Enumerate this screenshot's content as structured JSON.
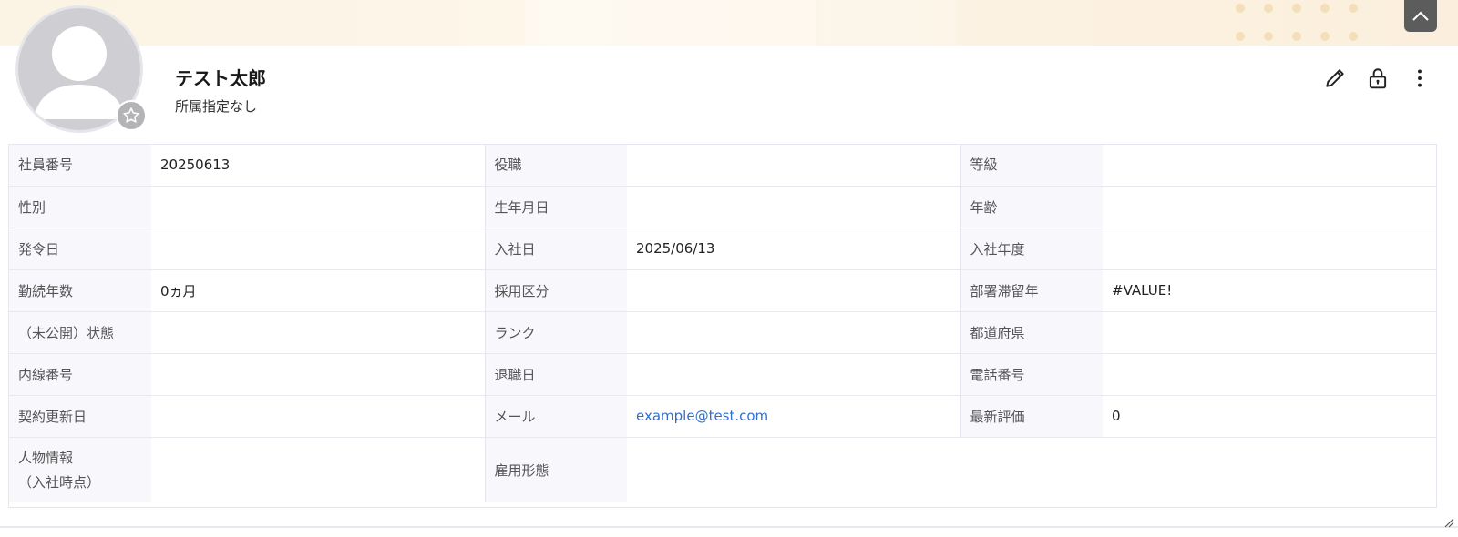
{
  "profile": {
    "name": "テスト太郎",
    "department": "所属指定なし"
  },
  "icons": {
    "scroll_top": "chevron-up-icon",
    "favorite": "star-icon",
    "edit": "pencil-icon",
    "lock": "lock-icon",
    "more": "more-vertical-icon"
  },
  "fields": {
    "row1": {
      "l1": "社員番号",
      "v1": "20250613",
      "l2": "役職",
      "v2": "",
      "l3": "等級",
      "v3": ""
    },
    "row2": {
      "l1": "性別",
      "v1": "",
      "l2": "生年月日",
      "v2": "",
      "l3": "年齢",
      "v3": ""
    },
    "row3": {
      "l1": "発令日",
      "v1": "",
      "l2": "入社日",
      "v2": "2025/06/13",
      "l3": "入社年度",
      "v3": ""
    },
    "row4": {
      "l1": "勤続年数",
      "v1": "0ヵ月",
      "l2": "採用区分",
      "v2": "",
      "l3": "部署滞留年",
      "v3": "#VALUE!"
    },
    "row5": {
      "l1": "（未公開）状態",
      "v1": "",
      "l2": "ランク",
      "v2": "",
      "l3": "都道府県",
      "v3": ""
    },
    "row6": {
      "l1": "内線番号",
      "v1": "",
      "l2": "退職日",
      "v2": "",
      "l3": "電話番号",
      "v3": ""
    },
    "row7": {
      "l1": "契約更新日",
      "v1": "",
      "l2": "メール",
      "v2": "example@test.com",
      "l3": "最新評価",
      "v3": "0"
    },
    "row8": {
      "l1a": "人物情報",
      "l1b": "（入社時点）",
      "v1": "",
      "l2": "雇用形態",
      "v2": ""
    }
  },
  "colors": {
    "banner": "#fbf3e3",
    "label_bg": "#f8f7fc",
    "link": "#2f6fd0",
    "top_button": "#5c5c5c"
  }
}
